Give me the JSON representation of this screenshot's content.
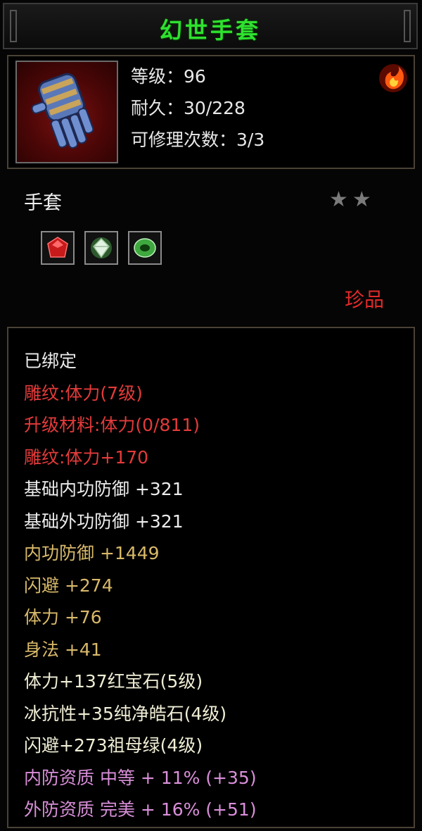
{
  "title": "幻世手套",
  "item": {
    "stats": [
      "等级：96",
      "耐久：30/228",
      "可修理次数：3/3"
    ],
    "type": "手套",
    "stars": "★★",
    "rarity": "珍品",
    "sockets": [
      {
        "name": "ruby-gem-icon",
        "color": "#c81a1a"
      },
      {
        "name": "diamond-gem-icon",
        "color": "#d0e8d0"
      },
      {
        "name": "emerald-gem-icon",
        "color": "#3fa83f"
      }
    ]
  },
  "attributes": [
    {
      "text": "已绑定",
      "color": "white"
    },
    {
      "text": "雕纹:体力(7级)",
      "color": "red"
    },
    {
      "text": "升级材料:体力(0/811)",
      "color": "red"
    },
    {
      "text": "雕纹:体力+170",
      "color": "red"
    },
    {
      "text": "基础内功防御 +321",
      "color": "white"
    },
    {
      "text": "基础外功防御 +321",
      "color": "white"
    },
    {
      "text": "内功防御 +1449",
      "color": "gold"
    },
    {
      "text": "闪避 +274",
      "color": "gold"
    },
    {
      "text": "体力 +76",
      "color": "gold"
    },
    {
      "text": "身法 +41",
      "color": "gold"
    },
    {
      "text": "体力+137红宝石(5级)",
      "color": "cream"
    },
    {
      "text": "冰抗性+35纯净皓石(4级)",
      "color": "cream"
    },
    {
      "text": "闪避+273祖母绿(4级)",
      "color": "cream"
    },
    {
      "text": "内防资质 中等 + 11% (+35)",
      "color": "pink"
    },
    {
      "text": "外防资质 完美 + 16% (+51)",
      "color": "pink"
    }
  ]
}
